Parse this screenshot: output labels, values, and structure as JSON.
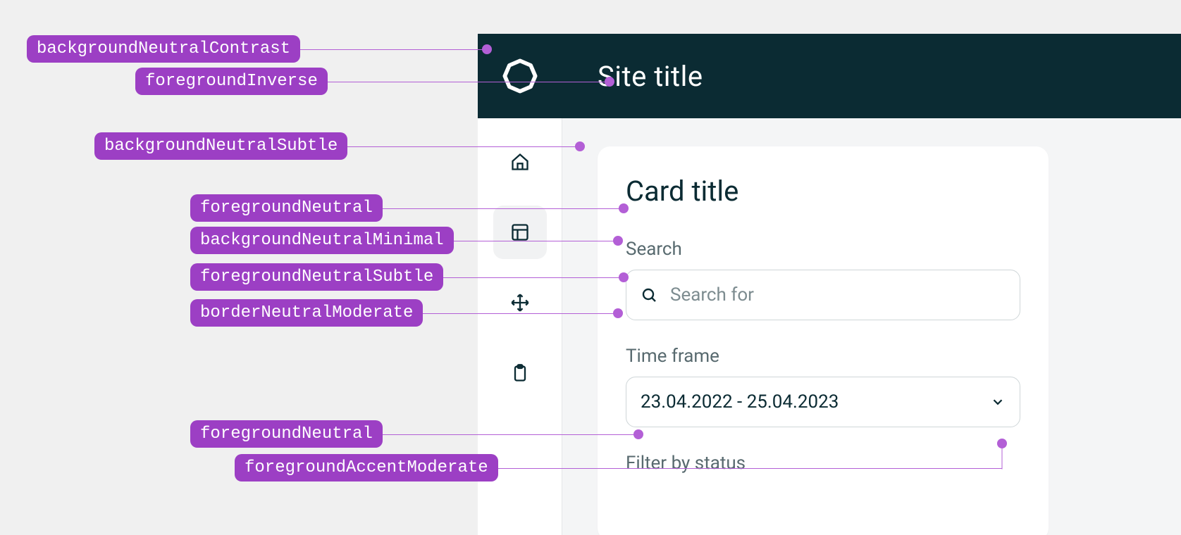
{
  "annotations": {
    "a0": "backgroundNeutralContrast",
    "a1": "foregroundInverse",
    "a2": "backgroundNeutralSubtle",
    "a3": "foregroundNeutral",
    "a4": "backgroundNeutralMinimal",
    "a5": "foregroundNeutralSubtle",
    "a6": "borderNeutralModerate",
    "a7": "foregroundNeutral",
    "a8": "foregroundAccentModerate"
  },
  "header": {
    "site_title": "Site title"
  },
  "sidebar": {
    "items": [
      {
        "icon": "home-icon"
      },
      {
        "icon": "layout-icon"
      },
      {
        "icon": "move-icon"
      },
      {
        "icon": "clipboard-icon"
      }
    ]
  },
  "card": {
    "title": "Card title",
    "search_label": "Search",
    "search_placeholder": "Search for",
    "timeframe_label": "Time frame",
    "timeframe_value": "23.04.2022 - 25.04.2023",
    "filter_label": "Filter by status"
  }
}
